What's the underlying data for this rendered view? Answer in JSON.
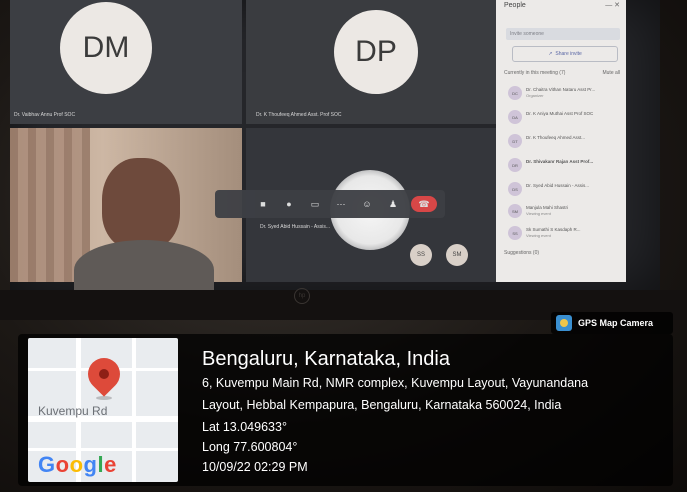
{
  "meeting": {
    "tiles": [
      {
        "initials": "DM",
        "name": "Dr. Vaibhav Annu Prof SOC"
      },
      {
        "initials": "DP",
        "name": "Dr. K Thoufeeq Ahmed Asst. Prof SOC"
      },
      {
        "initials": "",
        "name": "Dr. Syed Abid Hussain - Assis..."
      }
    ],
    "small_avatars": [
      "SS",
      "SM"
    ]
  },
  "people_panel": {
    "title": "People",
    "search_placeholder": "Invite someone",
    "share_invite_label": "Share invite",
    "in_meeting_label": "Currently in this meeting (7)",
    "mute_all_label": "Mute all",
    "participants": [
      {
        "initials": "DC",
        "name": "Dr. Chaitra Vithan Nataru Asst Pr...",
        "sub": "Organizer"
      },
      {
        "initials": "DA",
        "name": "Dr. K Aniya Muthai Asst Prof SOC",
        "sub": ""
      },
      {
        "initials": "DT",
        "name": "Dr. K Thoufeeq Ahmed Asst...",
        "sub": ""
      },
      {
        "initials": "DR",
        "name": "Dr. Shivakanr Rajan Asst Prof...",
        "sub": ""
      },
      {
        "initials": "DS",
        "name": "Dr. Syed Abid Hussain - Assis...",
        "sub": ""
      },
      {
        "initials": "SM",
        "name": "Manjula Mahi Shastri",
        "sub": "Viewing event"
      },
      {
        "initials": "SS",
        "name": "Sk Sumathi S Kasdaph R...",
        "sub": "Viewing event"
      }
    ],
    "footer_label": "Suggestions (0)"
  },
  "gps": {
    "badge_label": "GPS Map Camera",
    "map_road_label": "Kuvempu Rd",
    "map_brand": [
      "G",
      "o",
      "o",
      "g",
      "l",
      "e"
    ],
    "title": "Bengaluru, Karnataka, India",
    "address_line1": "6, Kuvempu Main Rd, NMR complex, Kuvempu Layout, Vayunandana",
    "address_line2": "Layout, Hebbal Kempapura, Bengaluru, Karnataka 560024, India",
    "lat": "Lat 13.049633°",
    "long": "Long 77.600804°",
    "datetime": "10/09/22 02:29 PM"
  },
  "laptop": {
    "logo": "hp"
  }
}
